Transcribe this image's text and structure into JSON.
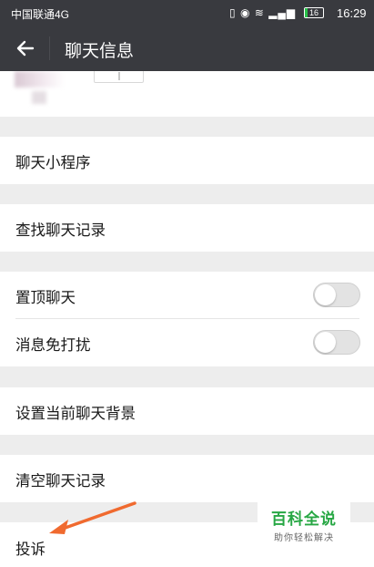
{
  "status_bar": {
    "carrier": "中国联通4G",
    "battery": "16",
    "battery_level": 0.16,
    "time": "16:29",
    "signal_label": "4G"
  },
  "header": {
    "title": "聊天信息",
    "back_icon": "arrow-left-icon"
  },
  "sections": {
    "mini_programs": "聊天小程序",
    "search_history": "查找聊天记录",
    "sticky_on_top": "置顶聊天",
    "mute_notifications": "消息免打扰",
    "set_background": "设置当前聊天背景",
    "clear_history": "清空聊天记录",
    "report": "投诉"
  },
  "toggles": {
    "sticky_on_top": false,
    "mute_notifications": false
  },
  "watermark": {
    "title": "百科全说",
    "subtitle": "助你轻松解决"
  },
  "colors": {
    "bar": "#393a3f",
    "background": "#ededed",
    "annotation_arrow": "#f06a2f",
    "watermark_green": "#27a744"
  }
}
